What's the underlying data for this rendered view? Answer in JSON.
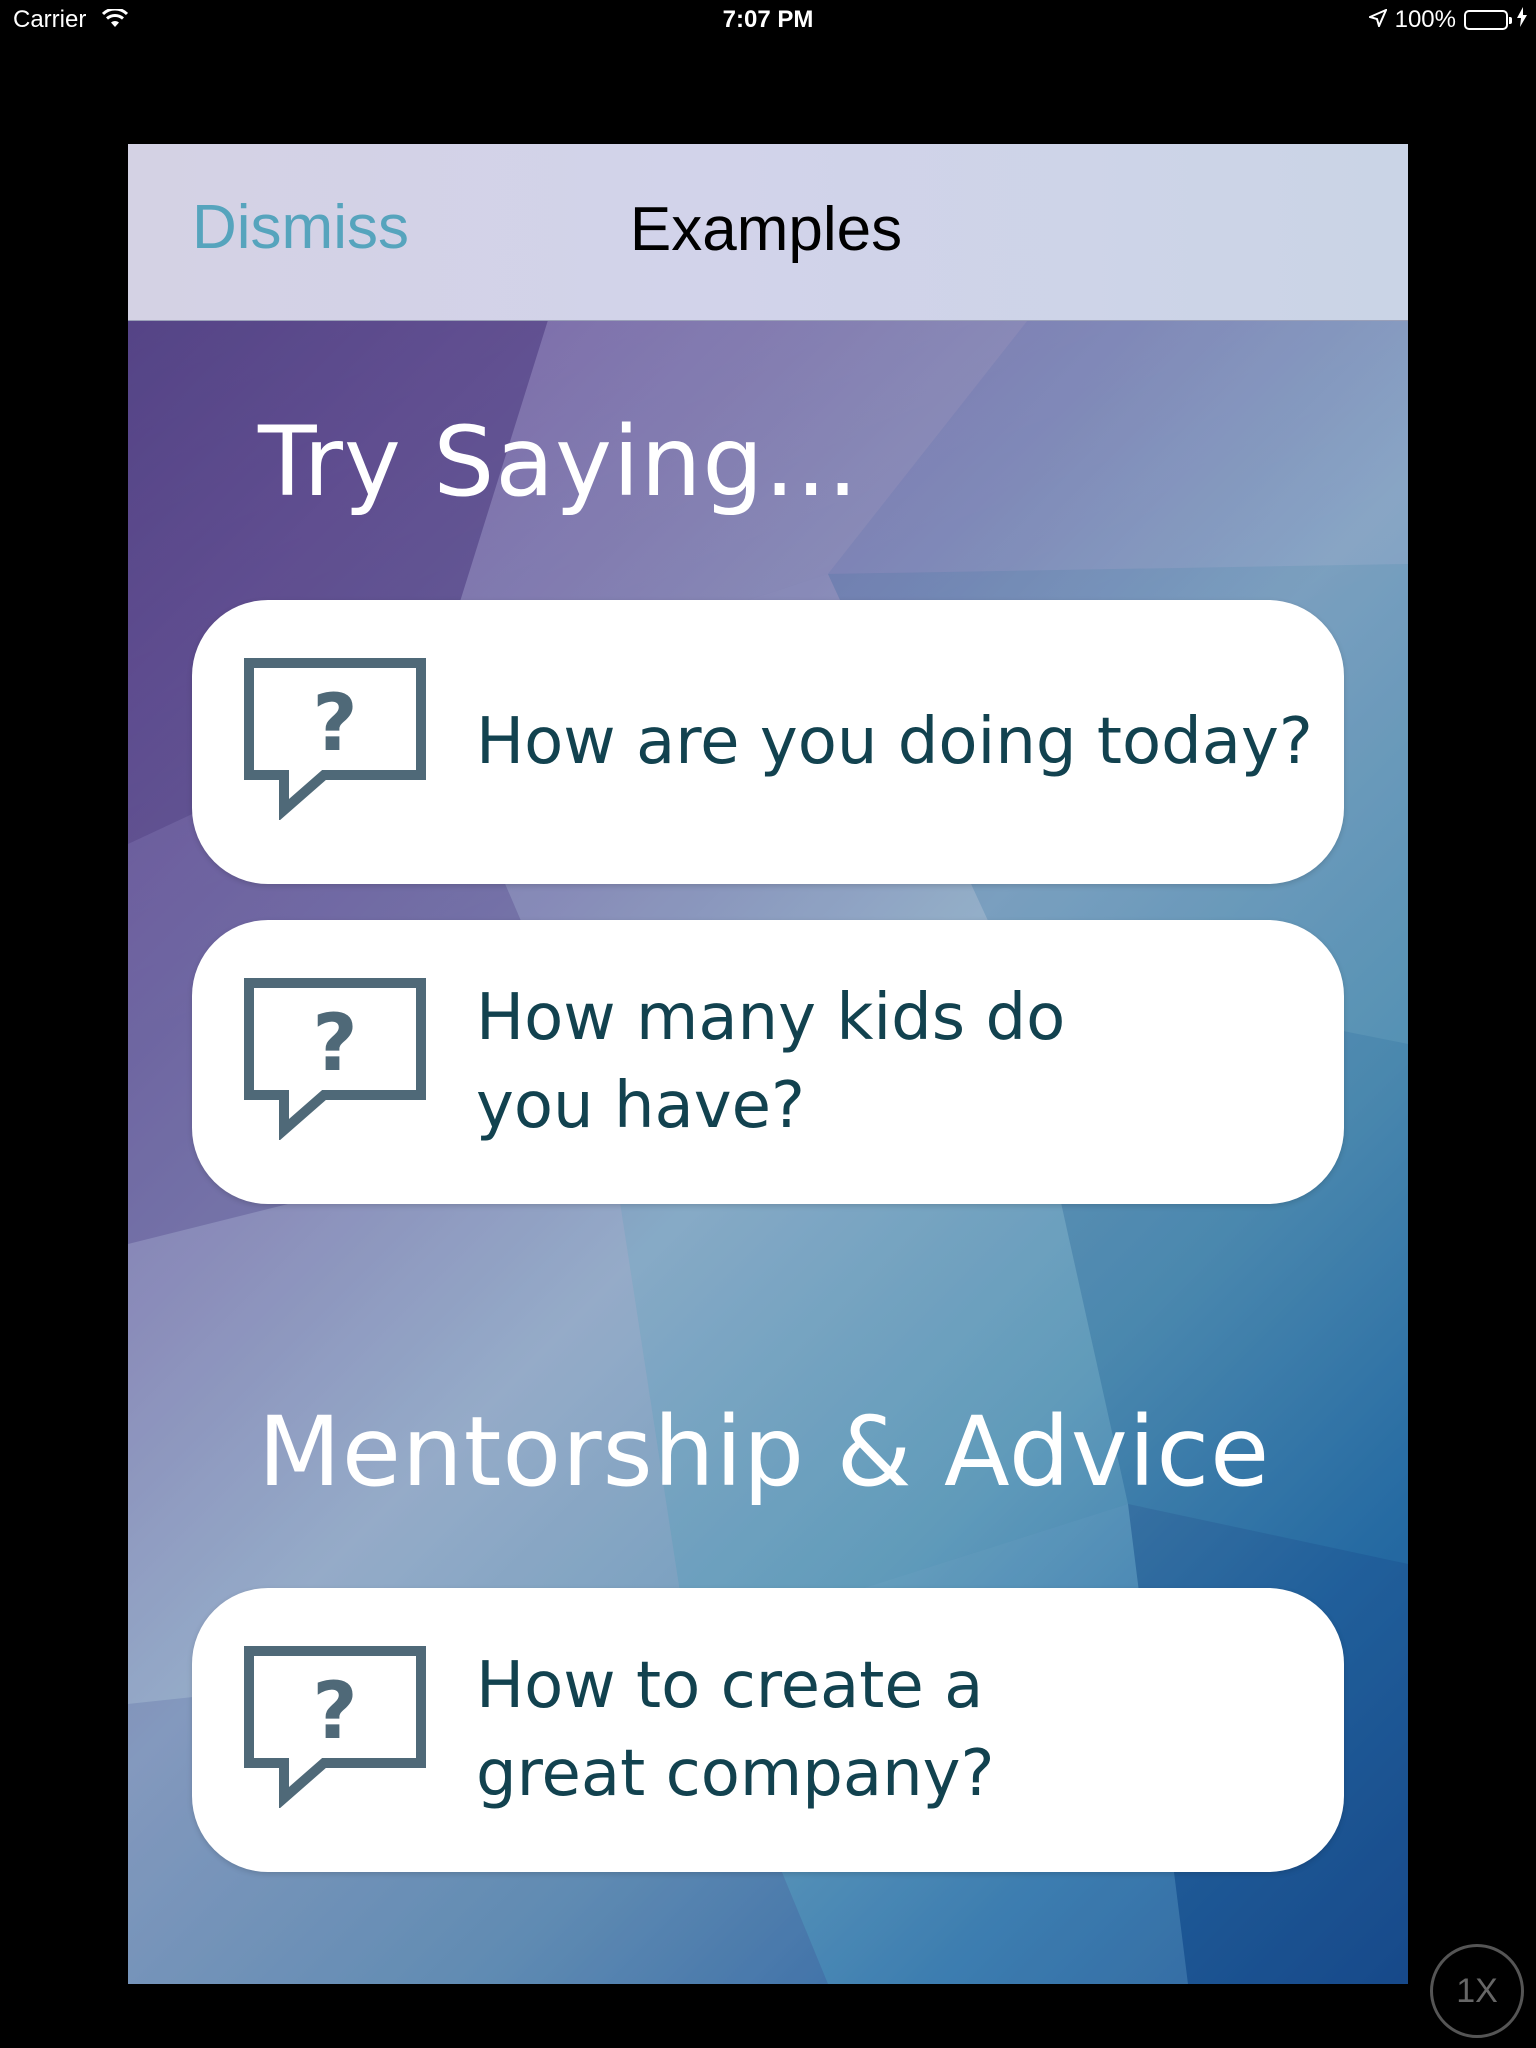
{
  "status_bar": {
    "carrier": "Carrier",
    "time": "7:07 PM",
    "battery": "100%"
  },
  "nav": {
    "dismiss_label": "Dismiss",
    "title": "Examples"
  },
  "sections": [
    {
      "heading": "Try Saying...",
      "items": [
        {
          "line1": "How are you doing today?",
          "line2": ""
        },
        {
          "line1": "How many kids do",
          "line2": "you have?"
        }
      ]
    },
    {
      "heading": "Mentorship & Advice",
      "items": [
        {
          "line1": "How to create a",
          "line2": "great company?"
        }
      ]
    }
  ],
  "overlay": {
    "speed": "1X"
  },
  "icons": {
    "question": "question-speech-bubble-icon"
  },
  "colors": {
    "accent": "#56a4bd",
    "card_text": "#12424f",
    "icon": "#4f6978"
  }
}
